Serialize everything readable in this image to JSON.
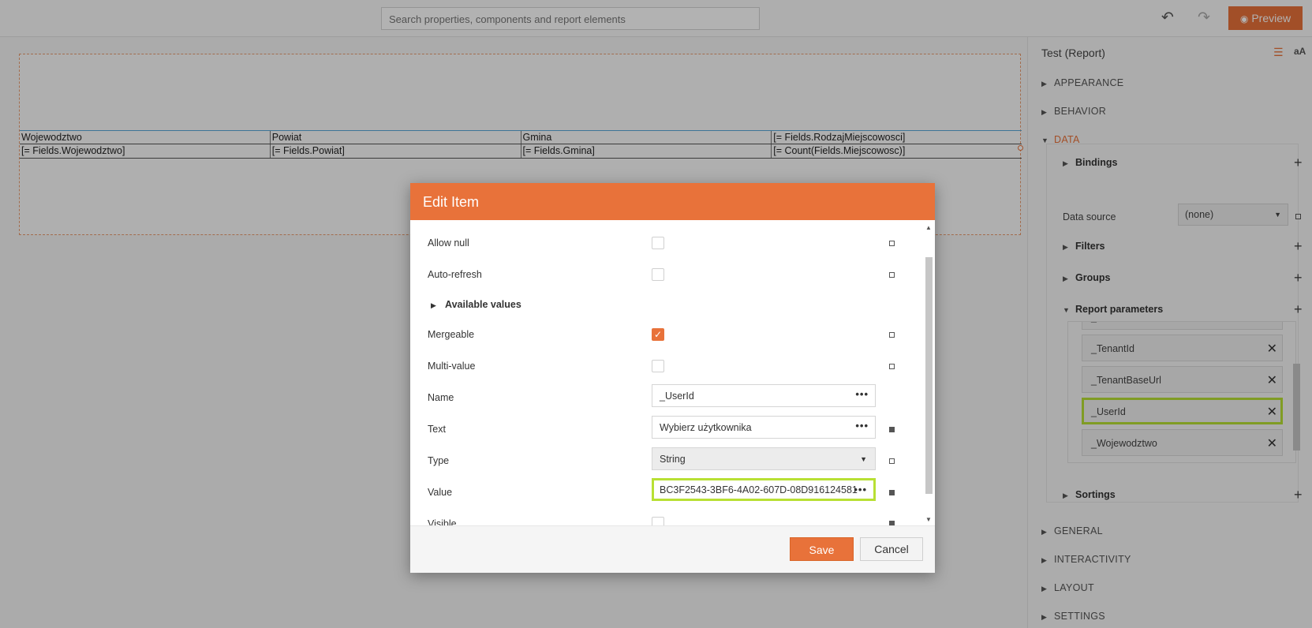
{
  "topbar": {
    "search_placeholder": "Search properties, components and report elements",
    "preview_label": "Preview"
  },
  "report": {
    "headers": [
      "Wojewodztwo",
      "Powiat",
      "Gmina",
      "[= Fields.RodzajMiejscowosci]"
    ],
    "row": [
      "[= Fields.Wojewodztwo]",
      "[= Fields.Powiat]",
      "[= Fields.Gmina]",
      "[= Count(Fields.Miejscowosc)]"
    ]
  },
  "panel": {
    "title": "Test (Report)",
    "aa_label": "aA",
    "sections": {
      "appearance": "APPEARANCE",
      "behavior": "BEHAVIOR",
      "data": "DATA",
      "general": "GENERAL",
      "interactivity": "INTERACTIVITY",
      "layout": "LAYOUT",
      "settings": "SETTINGS"
    },
    "data": {
      "bindings": "Bindings",
      "data_source_label": "Data source",
      "data_source_value": "(none)",
      "filters": "Filters",
      "groups": "Groups",
      "report_parameters": "Report parameters",
      "sortings": "Sortings",
      "parameters": [
        "_TenantId",
        "_TenantBaseUrl",
        "_UserId",
        "_Wojewodztwo"
      ]
    }
  },
  "dialog": {
    "title": "Edit Item",
    "allow_null": "Allow null",
    "auto_refresh": "Auto-refresh",
    "available_values": "Available values",
    "mergeable": "Mergeable",
    "multi_value": "Multi-value",
    "name_label": "Name",
    "name_value": "_UserId",
    "text_label": "Text",
    "text_value": "Wybierz użytkownika",
    "type_label": "Type",
    "type_value": "String",
    "value_label": "Value",
    "value_value": "BC3F2543-3BF6-4A02-607D-08D916124581",
    "visible_label": "Visible",
    "save_label": "Save",
    "cancel_label": "Cancel"
  }
}
